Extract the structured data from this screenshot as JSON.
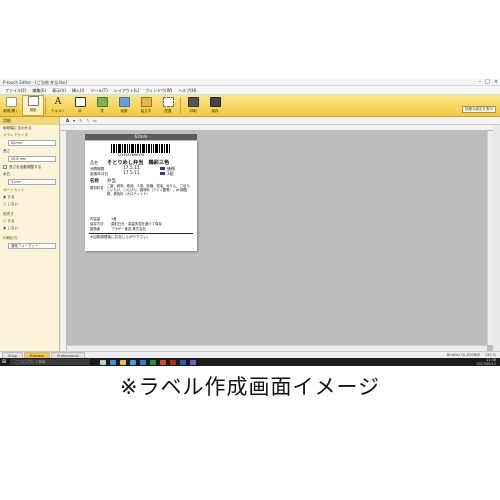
{
  "window": {
    "title": "P-touch Editor - [ご当地 弁当.lbx]",
    "controls": [
      "–",
      "□",
      "×"
    ]
  },
  "menubar": {
    "items": [
      "ファイル(F)",
      "編集(E)",
      "表示(V)",
      "挿入(I)",
      "ツール(T)",
      "レイアウト(L)",
      "ウィンドウ(W)",
      "ヘルプ(H)"
    ]
  },
  "ribbon": {
    "buttons": [
      {
        "label": "新規/開く",
        "icon": "new-document-icon",
        "color": "#ffffff"
      },
      {
        "label": "用紙",
        "icon": "paper-icon",
        "color": "#ffffff"
      },
      {
        "label": "テキスト",
        "icon": "text-icon",
        "color": "#3a3a3a"
      },
      {
        "label": "枠",
        "icon": "frame-icon",
        "color": "#ffffff"
      },
      {
        "label": "表",
        "icon": "table-icon",
        "color": "#7fae5a"
      },
      {
        "label": "画像",
        "icon": "image-icon",
        "color": "#6aa0d8"
      },
      {
        "label": "絵文字",
        "icon": "symbol-icon",
        "color": "#e3b64a"
      },
      {
        "label": "配置",
        "icon": "arrange-icon",
        "color": "#ffffff"
      },
      {
        "label": "印刷",
        "icon": "print-icon",
        "color": "#555555"
      },
      {
        "label": "保存",
        "icon": "save-icon",
        "color": "#444444"
      }
    ],
    "right_label": "詳細な設定を表示"
  },
  "left_panel": {
    "header": "用紙",
    "printer_note": "用紙幅に合わせる",
    "media_label": "メディアサイズ",
    "media_value": "62mm",
    "length_label": "長さ",
    "length_value": "59.8 mm",
    "auto_length": "長さを自動調整する",
    "margin_label": "余白",
    "margin_value": "3 mm",
    "cut_label": "オートカット",
    "cut_on": "する",
    "cut_off": "しない",
    "vertical_label": "縦書き",
    "vertical_on": "する",
    "vertical_off": "しない",
    "format_label": "印刷形式",
    "format_value": "通常フォーマット"
  },
  "canvas": {
    "width_tag": "62mm"
  },
  "label": {
    "barcode_number": "1234567890128",
    "line1_key": "品名",
    "line1_value": "そとりめし弁当　鶏彩三色",
    "line2_key": "消費期限",
    "line2_value": "17.5.11",
    "line2_extra": "価格",
    "line3_key": "製造年月日",
    "line3_value": "17.5.11",
    "line3_extra": "1個",
    "line4_key": "名称",
    "line4_value": "弁当",
    "ingredients_key": "原材料名",
    "ingredients_value": "ご飯、鶏肉、鶏卵、人参、砂糖、醤油、みりん、ごぼう、しいたけ、いんげん、調味料（アミノ酸等）、pH調整剤、着色料（カロテノイド）",
    "net_key": "内容量",
    "net_value": "1食",
    "storage_key": "保存方法",
    "storage_value": "直射日光・高温多湿を避けて保存",
    "maker_key": "製造者",
    "maker_value": "ブラザー食品 株式会社",
    "allergy": "※加熱調理後にお召し上がり下さい。"
  },
  "statusbar": {
    "tab_snap": "Snap",
    "tab_express": "Express",
    "tab_professional": "Professional",
    "printer": "Brother QL-820NW",
    "zoom": "150 %"
  },
  "taskbar": {
    "search_placeholder": "ここに入力して検索",
    "time": "11:36",
    "date": "2017/05/11",
    "apps": [
      {
        "name": "task-view-icon",
        "color": "#cccccc"
      },
      {
        "name": "edge-icon",
        "color": "#3a8ee6"
      },
      {
        "name": "explorer-icon",
        "color": "#f0c24a"
      },
      {
        "name": "store-icon",
        "color": "#4a9ae6"
      },
      {
        "name": "mail-icon",
        "color": "#2c7fd6"
      },
      {
        "name": "excel-icon",
        "color": "#2e8b4f"
      },
      {
        "name": "powerpoint-icon",
        "color": "#d04a2a"
      },
      {
        "name": "acrobat-icon",
        "color": "#c8201a"
      },
      {
        "name": "word-icon",
        "color": "#2b5bb5"
      },
      {
        "name": "ptouch-icon",
        "color": "#7a5cc2"
      }
    ]
  },
  "caption": "※ラベル作成画面イメージ"
}
